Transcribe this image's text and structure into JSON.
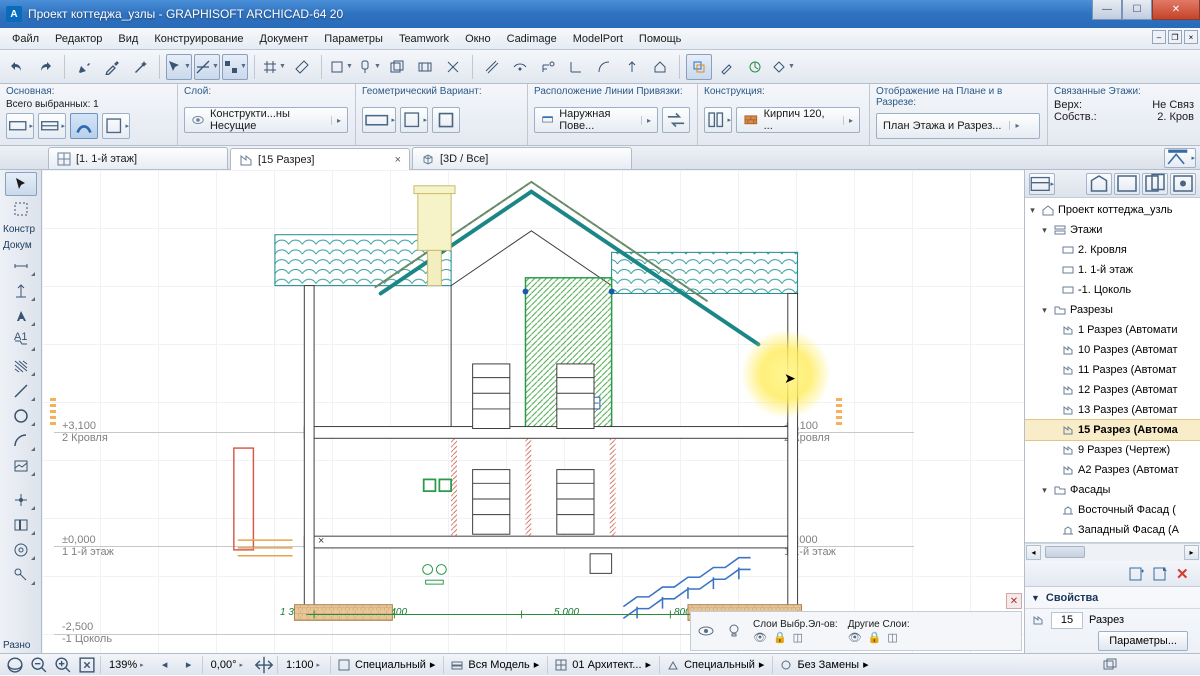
{
  "title": "Проект коттеджа_узлы - GRAPHISOFT ARCHICAD-64 20",
  "menu": [
    "Файл",
    "Редактор",
    "Вид",
    "Конструирование",
    "Документ",
    "Параметры",
    "Teamwork",
    "Окно",
    "Cadimage",
    "ModelPort",
    "Помощь"
  ],
  "info": {
    "sel_hdr": "Основная:",
    "sel_sub": "Всего выбранных: 1",
    "layer_hdr": "Слой:",
    "layer_combo": "Конструкти...ны Несущие",
    "geom_hdr": "Геометрический Вариант:",
    "snap_hdr": "Расположение Линии Привязки:",
    "snap_combo": "Наружная Пове...",
    "cons_hdr": "Конструкция:",
    "cons_combo": "Кирпич 120, ...",
    "disp_hdr": "Отображение на Плане и в Разрезе:",
    "disp_combo": "План Этажа и Разрез...",
    "link_hdr": "Связанные Этажи:",
    "link_l1": "Верх:",
    "link_v1": "Не Связ",
    "link_l2": "Собств.:",
    "link_v2": "2. Кров"
  },
  "tabs": {
    "t1": "[1. 1-й этаж]",
    "t2": "[15 Разрез]",
    "t3": "[3D / Все]"
  },
  "tools": {
    "konstr": "Констр",
    "dokum": "Докум",
    "razno": "Разно"
  },
  "levels": {
    "l1e": "+3,100",
    "l1n": "2 Кровля",
    "l2e": "±0,000",
    "l2n": "1 1-й этаж",
    "l3e": "-2,500",
    "l3n": "-1 Цоколь",
    "d1": "1 300",
    "d2": "4 400",
    "d3": "5 000",
    "d4": "800"
  },
  "nav": {
    "root": "Проект коттеджа_узль",
    "g_floors": "Этажи",
    "f1": "2. Кровля",
    "f2": "1. 1-й этаж",
    "f3": "-1. Цоколь",
    "g_sec": "Разрезы",
    "s1": "1 Разрез (Автомати",
    "s2": "10 Разрез (Автомат",
    "s3": "11 Разрез (Автомат",
    "s4": "12 Разрез (Автомат",
    "s5": "13 Разрез (Автомат",
    "s6": "15 Разрез (Автома",
    "s7": "9 Разрез (Чертеж)",
    "s8": "A2 Разрез (Автомат",
    "g_fac": "Фасады",
    "e1": "Восточный Фасад (",
    "e2": "Западный Фасад (А"
  },
  "props": {
    "hdr": "Свойства",
    "num": "15",
    "name": "Разрез",
    "btn": "Параметры..."
  },
  "layerrow": {
    "g1": "Слои Выбр.Эл-ов:",
    "g2": "Другие Слои:"
  },
  "status": {
    "zoom": "139%",
    "ang": "0,00°",
    "scale": "1:100",
    "s1": "Специальный",
    "s2": "Вся Модель",
    "s3": "01 Архитект...",
    "s4": "Специальный",
    "s5": "Без Замены"
  }
}
